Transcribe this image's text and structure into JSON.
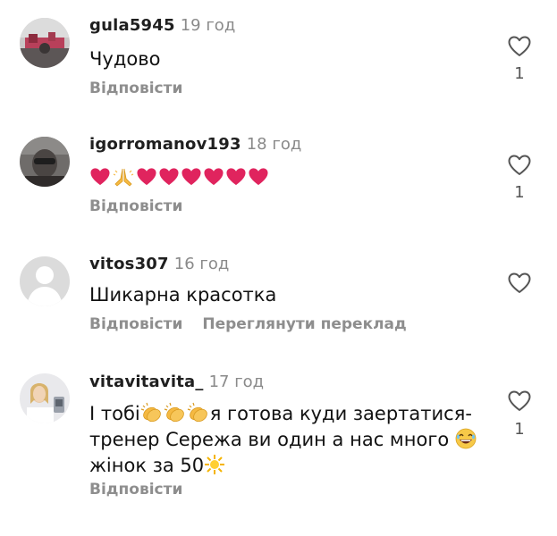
{
  "comments": [
    {
      "username": "gula5945",
      "time": "19 год",
      "text": "Чудово",
      "reply": "Відповісти",
      "likes": "1"
    },
    {
      "username": "igorromanov193",
      "time": "18 год",
      "text": "",
      "emoji_sequence": [
        "heart",
        "praying-hands",
        "heart",
        "heart",
        "heart",
        "heart",
        "heart",
        "heart"
      ],
      "reply": "Відповісти",
      "likes": "1"
    },
    {
      "username": "vitos307",
      "time": "16 год",
      "text": "Шикарна красотка",
      "reply": "Відповісти",
      "translate": "Переглянути переклад",
      "likes": ""
    },
    {
      "username": "vitavitavita_",
      "time": "17 год",
      "text_parts": [
        "І тобі",
        "я готова куди заертатися-тренер Сережа ви один а нас много ",
        "жінок за 50"
      ],
      "reply": "Відповісти",
      "likes": "1"
    }
  ],
  "colors": {
    "text": "#121212",
    "muted": "#8e8e8e",
    "heart_red": "#e0245e",
    "background": "#ffffff"
  },
  "icons": [
    "heart-outline-icon",
    "red-heart-emoji",
    "praying-hands-emoji",
    "clapping-hands-emoji",
    "laughing-face-emoji",
    "sun-emoji"
  ]
}
